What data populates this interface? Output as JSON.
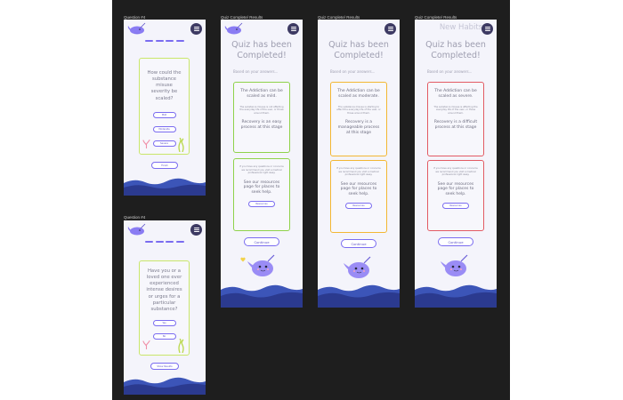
{
  "frames": {
    "q3_label": "Question #4",
    "q4_label": "Question #4",
    "r1_label": "Quiz Complete/ Results",
    "r2_label": "Quiz Complete/ Results",
    "r3_label": "Quiz Complete/ Results"
  },
  "q3": {
    "question": "How could the substance misuse severity be scaled?",
    "options": [
      "Mild",
      "Moderate",
      "Severe"
    ],
    "next": "Finish"
  },
  "q4": {
    "question": "Have you or a loved one ever experienced intense desires or urges for a particular substance?",
    "options": [
      "Yes",
      "No"
    ],
    "next": "Show Results"
  },
  "results": [
    {
      "title": "Quiz has been Completed!",
      "based_on": "Based on your answers...",
      "headline": "The Addiction can be scaled as mild.",
      "detail": "The substance misuse is not affecting the everyday life of the user, or those around them.",
      "recovery": "Recovery is an easy process at this stage",
      "contact": "If you have any questions or concerns we recommend you visit a medical professional right away.",
      "resources": "See our resources page for places to seek help.",
      "resources_button": "Resources",
      "continue": "Continue"
    },
    {
      "title": "Quiz has been Completed!",
      "based_on": "Based on your answers...",
      "headline": "The Addiction can be scaled as moderate.",
      "detail": "The substance misuse is starting to effect the everyday life of the user, or those around them.",
      "recovery": "Recovery is a manageable process at this stage",
      "contact": "If you have any questions or concerns we recommend you visit a medical professional right away.",
      "resources": "See our resources page for places to seek help.",
      "resources_button": "Resources",
      "continue": "Continue"
    },
    {
      "ghost_title": "New Habits",
      "title": "Quiz has been Completed!",
      "based_on": "Based on your answers...",
      "headline": "The Addiction can be scaled as severe.",
      "detail": "The substance misuse is affecting the everyday life of the user, or those around them.",
      "recovery": "Recovery is a difficult process at this stage",
      "contact": "If you have any questions or concerns we recommend you visit a medical professional right away.",
      "resources": "See our resources page for places to seek help.",
      "resources_button": "Resources",
      "continue": "Continue"
    }
  ],
  "colors": {
    "canvas": "#1e1e1e",
    "screen": "#f4f4fb",
    "accent": "#7a6cf0",
    "menu": "#3d3a63",
    "mild": "#8fd24a",
    "moderate": "#f3b733",
    "severe": "#e25b64",
    "question_border": "#c9e66a",
    "wave_dark": "#2b3a8f",
    "wave_light": "#3c55b8"
  },
  "icons": [
    "narwhal-logo-icon",
    "hamburger-menu-icon",
    "narwhal-mascot-icon",
    "seaweed-icon",
    "coral-icon",
    "heart-icon"
  ]
}
